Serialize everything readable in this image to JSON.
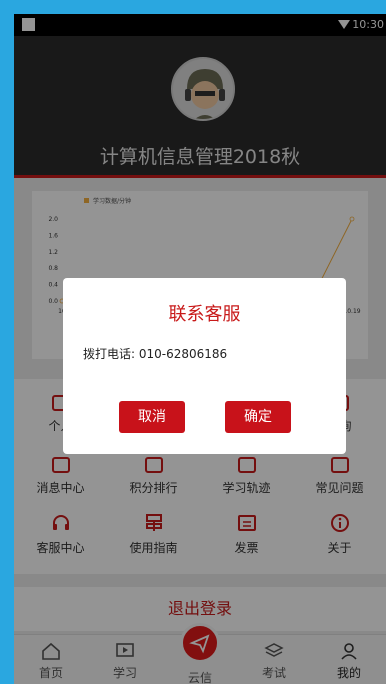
{
  "status_bar": {
    "time": "10:30"
  },
  "header": {
    "title": "计算机信息管理2018秋"
  },
  "chart_data": {
    "type": "line",
    "series": [
      {
        "name": "学习数据/分钟",
        "values": [
          0,
          0,
          0,
          0,
          0,
          0,
          0,
          2.0
        ]
      }
    ],
    "categories": [
      "10",
      "",
      "",
      "",
      "",
      "",
      "",
      "10.19"
    ],
    "yticks": [
      "2.0",
      "1.6",
      "1.2",
      "0.8",
      "0.4",
      "0.0"
    ],
    "ylim": [
      0,
      2.0
    ],
    "color": "#f5b041"
  },
  "menu": {
    "row1": [
      {
        "label": "个人",
        "icon": "person-icon"
      },
      {
        "label": "",
        "icon": ""
      },
      {
        "label": "",
        "icon": ""
      },
      {
        "label": "查询",
        "icon": "query-icon"
      }
    ],
    "row2": [
      {
        "label": "消息中心",
        "icon": "message-icon"
      },
      {
        "label": "积分排行",
        "icon": "ranking-icon"
      },
      {
        "label": "学习轨迹",
        "icon": "track-icon"
      },
      {
        "label": "常见问题",
        "icon": "faq-icon"
      }
    ],
    "row3": [
      {
        "label": "客服中心",
        "icon": "headset-icon"
      },
      {
        "label": "使用指南",
        "icon": "guide-icon"
      },
      {
        "label": "发票",
        "icon": "invoice-icon"
      },
      {
        "label": "关于",
        "icon": "info-icon"
      }
    ]
  },
  "logout_label": "退出登录",
  "tabs": [
    {
      "label": "首页",
      "icon": "home-icon"
    },
    {
      "label": "学习",
      "icon": "study-icon"
    },
    {
      "label": "云信",
      "icon": "send-icon"
    },
    {
      "label": "考试",
      "icon": "exam-icon"
    },
    {
      "label": "我的",
      "icon": "profile-icon"
    }
  ],
  "dialog": {
    "title": "联系客服",
    "message": "拨打电话: 010-62806186",
    "cancel": "取消",
    "confirm": "确定"
  },
  "colors": {
    "accent": "#c81a1a",
    "header_bg": "#2b2b2b"
  }
}
